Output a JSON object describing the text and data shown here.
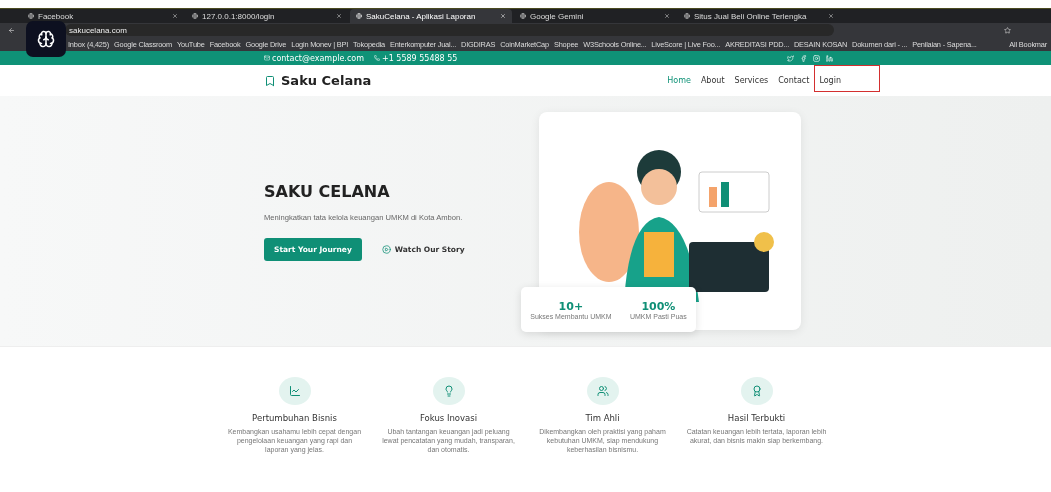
{
  "browser": {
    "tabs": [
      {
        "title": "Facebook",
        "selected": false
      },
      {
        "title": "127.0.0.1:8000/login",
        "selected": false
      },
      {
        "title": "SakuCelana - Aplikasi Laporan",
        "selected": true
      },
      {
        "title": "Google Gemini",
        "selected": false
      },
      {
        "title": "Situs Jual Beli Online Terlengka",
        "selected": false
      }
    ],
    "address": "sakucelana.com",
    "bookmarks": [
      "Inbox (4,425)",
      "Google Classroom",
      "YouTube",
      "Facebook",
      "Google Drive",
      "Login Monev | BPI",
      "Tokopedia",
      "Enterkomputer Jual...",
      "DIGDIRAS",
      "CoinMarketCap",
      "Shopee",
      "W3Schools Online...",
      "LiveScore | Live Foo...",
      "AKREDITASI PDD...",
      "DESAIN KOSAN",
      "Dokumen dari - ...",
      "Penilaian - Sapena..."
    ],
    "all_bookmarks": "All Bookmar"
  },
  "topbar": {
    "email": "contact@example.com",
    "phone": "+1 5589 55488 55"
  },
  "navbar": {
    "brand": "Saku Celana",
    "links": [
      {
        "label": "Home",
        "selected": true,
        "highlighted": false
      },
      {
        "label": "About",
        "selected": false,
        "highlighted": false
      },
      {
        "label": "Services",
        "selected": false,
        "highlighted": false
      },
      {
        "label": "Contact",
        "selected": false,
        "highlighted": false
      },
      {
        "label": "Login",
        "selected": false,
        "highlighted": true
      }
    ]
  },
  "hero": {
    "title": "SAKU CELANA",
    "subtitle": "Meningkatkan tata kelola keuangan UMKM di Kota Ambon.",
    "primary_button": "Start Your Journey",
    "secondary_button": "Watch Our Story",
    "stats": [
      {
        "value": "10+",
        "label": "Sukses Membantu UMKM"
      },
      {
        "value": "100%",
        "label": "UMKM Pasti Puas"
      }
    ]
  },
  "features": [
    {
      "kind": "chart",
      "title": "Pertumbuhan Bisnis",
      "text": "Kembangkan usahamu lebih cepat dengan pengelolaan keuangan yang rapi dan laporan yang jelas."
    },
    {
      "kind": "bulb",
      "title": "Fokus Inovasi",
      "text": "Ubah tantangan keuangan jadi peluang lewat pencatatan yang mudah, transparan, dan otomatis."
    },
    {
      "kind": "team",
      "title": "Tim Ahli",
      "text": "Dikembangkan oleh praktisi yang paham kebutuhan UMKM, siap mendukung keberhasilan bisnismu."
    },
    {
      "kind": "award",
      "title": "Hasil Terbukti",
      "text": "Catatan keuangan lebih tertata, laporan lebih akurat, dan bisnis makin siap berkembang."
    }
  ]
}
